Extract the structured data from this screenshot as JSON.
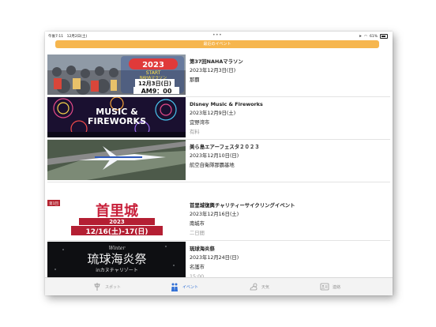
{
  "status": {
    "time_date": "午後7:11　12月2日(土)",
    "battery": "61%",
    "more_dots": "•••"
  },
  "header": {
    "title": "最近のイベント"
  },
  "events": [
    {
      "title": "第37回NAHAマラソン",
      "date": "2023年12月3日(日)",
      "place": "那覇",
      "extra": "",
      "thumb": {
        "year": "2023",
        "start": "START",
        "date": "12月3日(日)",
        "time": "AM9：00",
        "name": "NAHAマラソン"
      }
    },
    {
      "title": "Disney Music & Fireworks",
      "date": "2023年12月9日(土)",
      "place": "宜野湾市",
      "extra": "有料",
      "thumb": {
        "line1": "MUSIC &",
        "line2": "FIREWORKS"
      }
    },
    {
      "title": "美ら島エアーフェスタ２０２３",
      "date": "2023年12月10日(日)",
      "place": "航空自衛隊那覇基地",
      "extra": "",
      "thumb": {}
    },
    {
      "title": "首里城復興チャリティーサイクリングイベント",
      "date": "2023年12月16日(土)",
      "place": "南城市",
      "extra": "二日間",
      "thumb": {
        "badge": "第1回",
        "name": "首里城",
        "year": "2023",
        "dates": "12/16(土)-17(日)"
      }
    },
    {
      "title": "琉球海炎祭",
      "date": "2023年12月24日(日)",
      "place": "名護市",
      "extra": "15:00",
      "thumb": {
        "winter": "Winter",
        "name": "琉球海炎祭",
        "sub": "inカヌチャリゾート"
      }
    }
  ],
  "tabs": [
    {
      "label": "スポット",
      "icon": "pin-icon"
    },
    {
      "label": "イベント",
      "icon": "people-icon"
    },
    {
      "label": "天気",
      "icon": "cloud-sun-icon"
    },
    {
      "label": "連絡",
      "icon": "contact-card-icon"
    }
  ],
  "colors": {
    "accent": "#f6b64e",
    "active_tab": "#2f6fd6",
    "inactive_tab": "#9a9a9a"
  }
}
